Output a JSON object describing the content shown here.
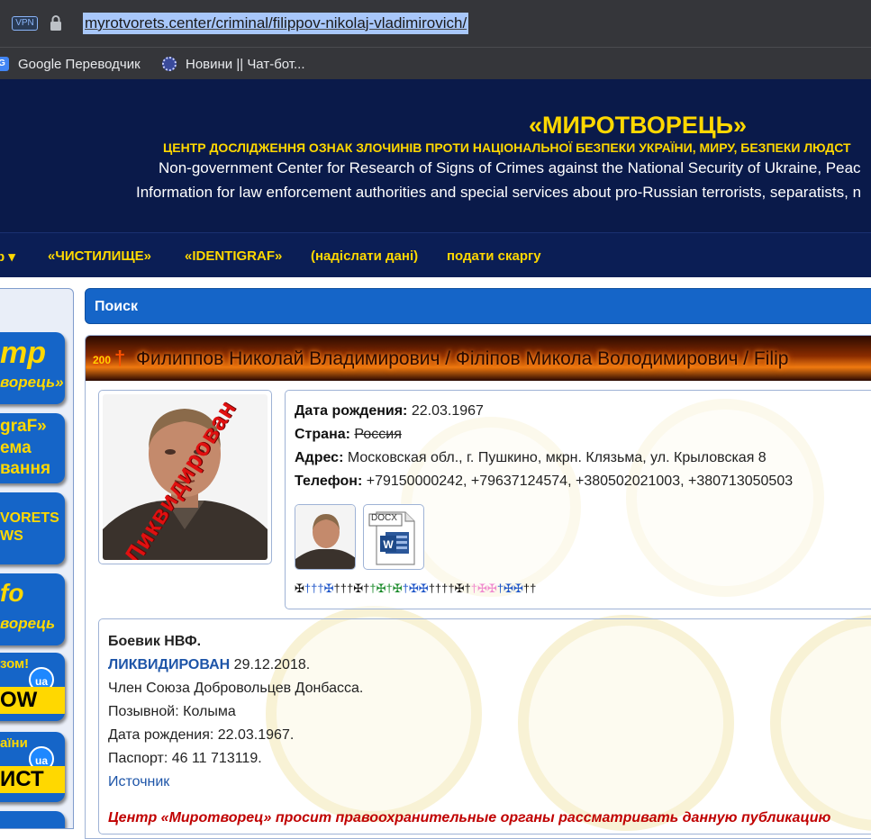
{
  "browser": {
    "vpn_label": "VPN",
    "url": "myrotvorets.center/criminal/filippov-nikolaj-vladimirovich/",
    "bookmarks": [
      {
        "label": "Google Переводчик",
        "icon": "google-translate-icon"
      },
      {
        "label": "Новини || Чат-бот...",
        "icon": "news-bot-icon"
      }
    ]
  },
  "header": {
    "title": "«МИРОТВОРЕЦЬ»",
    "subtitle": "ЦЕНТР ДОСЛІДЖЕННЯ ОЗНАК ЗЛОЧИНІВ ПРОТИ НАЦІОНАЛЬНОЇ БЕЗПЕКИ УКРАЇНИ, МИРУ, БЕЗПЕКИ ЛЮДСТ",
    "line_en_1": "Non-government Center for Research of Signs of Crimes against the National Security of Ukraine, Peac",
    "line_en_2": "Information for law enforcement authorities and special services about pro-Russian terrorists, separatists, n"
  },
  "nav": {
    "items": [
      "р ▾",
      "«ЧИСТИЛИЩЕ»",
      "«IDENTIGRAF»",
      "(надіслати дані)",
      "подати скаргу"
    ]
  },
  "sidebar": {
    "tiles": [
      {
        "line1": "тр",
        "line2": "ворець»"
      },
      {
        "line1": "graF»",
        "line2": "ема",
        "line3": "вання"
      },
      {
        "line1": "VORETS",
        "line2": "WS"
      },
      {
        "line1": "fo",
        "line2": "ворець"
      },
      {
        "line1": "зом!",
        "badge": "ua",
        "strip": "OW"
      },
      {
        "line1": "аїни",
        "badge": "ua",
        "strip": "ИСТ"
      }
    ]
  },
  "search": {
    "title": "Поиск"
  },
  "record": {
    "tag_200": "200",
    "cross": "†",
    "name": "Филиппов Николай Владимирович / Філіпов Микола Володимирович / Filip",
    "photo_stamp": "Ликвидирован",
    "fields": {
      "birth_label": "Дата рождения:",
      "birth_value": "22.03.1967",
      "country_label": "Страна:",
      "country_value": "Россия",
      "address_label": "Адрес:",
      "address_value": "Московская обл., г. Пушкино, мкрн. Клязьма, ул. Крыловская 8",
      "phone_label": "Телефон:",
      "phone_value": "+79150000242, +79637124574, +380502021003, +380713050503"
    },
    "docx_label": "DOCX",
    "details": {
      "role": "Боевик НВФ.",
      "status_label": "ЛИКВИДИРОВАН",
      "status_date": "29.12.2018.",
      "member": "Член Союза Добровольцев Донбасса.",
      "callsign": "Позывной: Колыма",
      "birth": "Дата рождения: 22.03.1967.",
      "passport": "Паспорт: 46 11 713119.",
      "source": "Источник",
      "warning": "Центр «Миротворец» просит правоохранительные органы рассматривать данную публикацию"
    }
  },
  "colors": {
    "header_bg": "#0a1a4a",
    "accent_yellow": "#ffd800",
    "panel_blue": "#1565c8",
    "warning_red": "#c00000",
    "stamp_red": "#e01010"
  }
}
